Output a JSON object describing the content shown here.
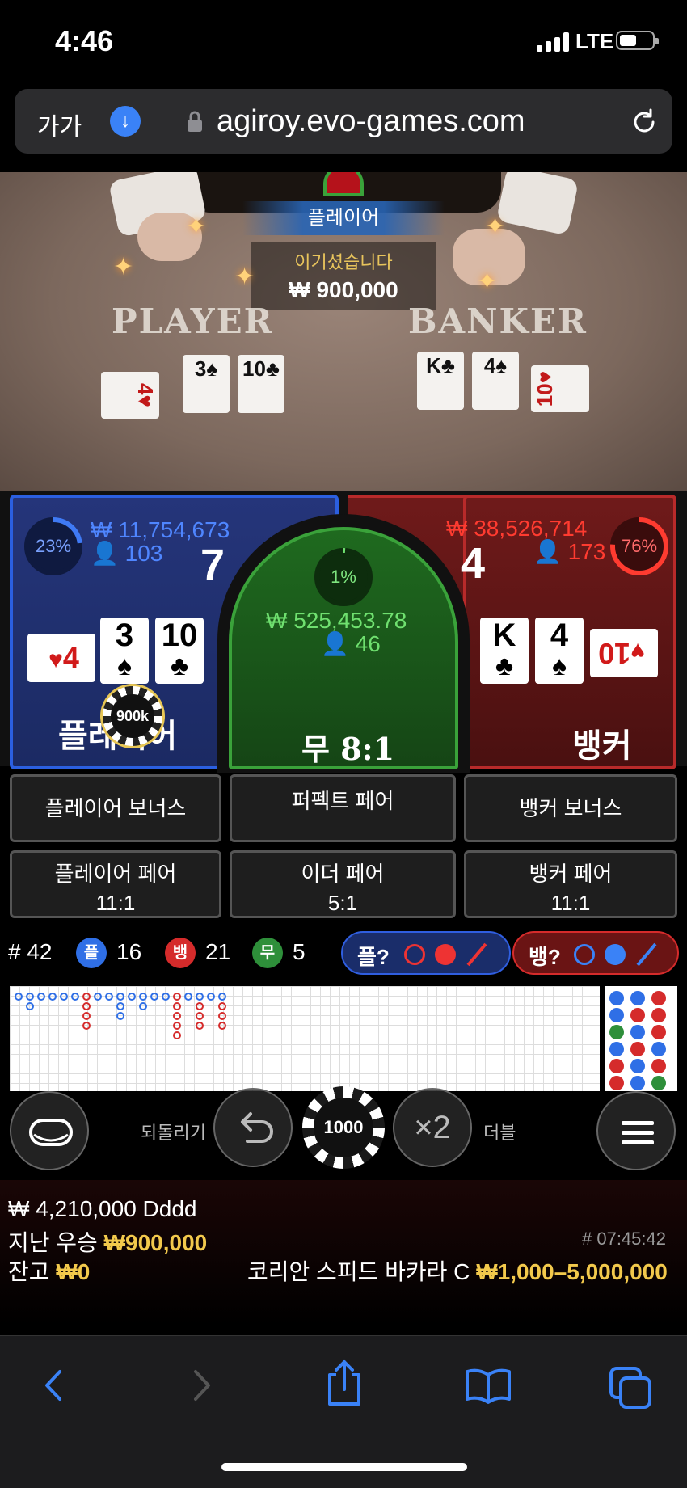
{
  "status": {
    "time": "4:46",
    "network": "LTE"
  },
  "browser": {
    "aa": "가가",
    "url": "agiroy.evo-games.com"
  },
  "video": {
    "player_label": "PLAYER",
    "banker_label": "BANKER",
    "result_banner": "플레이어",
    "win_text": "이기셨습니다",
    "win_amount": "₩ 900,000",
    "player_cards": [
      "4♥",
      "3♠",
      "10♣"
    ],
    "banker_cards": [
      "K♣",
      "4♠",
      "10♥"
    ]
  },
  "table": {
    "player": {
      "pct": "23%",
      "amount": "₩ 11,754,673",
      "players": "103",
      "score": "7",
      "label": "플레이어",
      "chip": "900k",
      "cards": [
        {
          "rank": "4",
          "suit": "♥",
          "color": "red"
        },
        {
          "rank": "3",
          "suit": "♠",
          "color": "black"
        },
        {
          "rank": "10",
          "suit": "♣",
          "color": "black"
        }
      ]
    },
    "tie": {
      "pct": "1%",
      "amount": "₩ 525,453.78",
      "players": "46",
      "label": "무 8:1"
    },
    "banker": {
      "pct": "76%",
      "amount": "₩ 38,526,714",
      "players": "173",
      "score": "4",
      "label": "뱅커",
      "cards": [
        {
          "rank": "K",
          "suit": "♣",
          "color": "black"
        },
        {
          "rank": "4",
          "suit": "♠",
          "color": "black"
        },
        {
          "rank": "10",
          "suit": "♥",
          "color": "red"
        }
      ]
    },
    "player_pct_value": 0.23,
    "banker_pct_value": 0.76,
    "tie_pct_value": 0.01
  },
  "sidebets": {
    "player_bonus": "플레이어 보너스",
    "perfect_pair": "퍼펙트 페어",
    "banker_bonus": "뱅커 보너스",
    "player_pair": "플레이어 페어",
    "player_pair_odds": "11:1",
    "either_pair": "이더 페어",
    "either_pair_odds": "5:1",
    "banker_pair": "뱅커 페어",
    "banker_pair_odds": "11:1"
  },
  "stats": {
    "round": "# 42",
    "player_glyph": "플",
    "player_count": "16",
    "banker_glyph": "뱅",
    "banker_count": "21",
    "tie_glyph": "무",
    "tie_count": "5",
    "player_ask": "플?",
    "banker_ask": "뱅?"
  },
  "controls": {
    "undo_label": "되돌리기",
    "chip_value": "1000",
    "double_symbol": "×2",
    "double_label": "더블"
  },
  "info": {
    "balance_line": "₩ 4,210,000 Dddd",
    "last_win_label": "지난 우승",
    "last_win_amount": "₩900,000",
    "round_time": "# 07:45:42",
    "balance_label": "잔고",
    "balance_amount": "₩0",
    "table_name": "코리안 스피드 바카라 C",
    "limits": "₩1,000–5,000,000"
  },
  "colors": {
    "player": "#2b5fe0",
    "banker": "#b82a2a",
    "tie": "#3aa23a",
    "gold": "#f2c94c"
  }
}
